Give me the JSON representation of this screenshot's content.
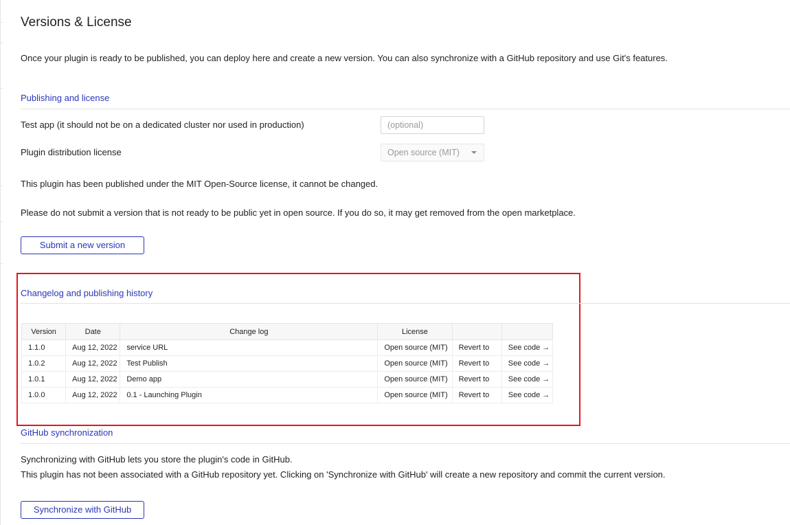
{
  "page": {
    "title": "Versions & License",
    "intro": "Once your plugin is ready to be published, you can deploy here and create a new version. You can also synchronize with a GitHub repository and use Git's features."
  },
  "publishing": {
    "section_title": "Publishing and license",
    "test_app_label": "Test app (it should not be on a dedicated cluster nor used in production)",
    "test_app_placeholder": "(optional)",
    "license_label": "Plugin distribution license",
    "license_value": "Open source (MIT)",
    "license_note": "This plugin has been published under the MIT Open-Source license, it cannot be changed.",
    "warning": "Please do not submit a version that is not ready to be public yet in open source. If you do so, it may get removed from the open marketplace.",
    "submit_label": "Submit a new version"
  },
  "changelog": {
    "section_title": "Changelog and publishing history",
    "columns": [
      "Version",
      "Date",
      "Change log",
      "License",
      "",
      ""
    ],
    "rows": [
      {
        "version": "1.1.0",
        "date": "Aug 12, 2022",
        "log": "service URL",
        "license": "Open source (MIT)",
        "revert": "Revert to",
        "code": "See code →"
      },
      {
        "version": "1.0.2",
        "date": "Aug 12, 2022",
        "log": "Test Publish",
        "license": "Open source (MIT)",
        "revert": "Revert to",
        "code": "See code →"
      },
      {
        "version": "1.0.1",
        "date": "Aug 12, 2022",
        "log": "Demo app",
        "license": "Open source (MIT)",
        "revert": "Revert to",
        "code": "See code →"
      },
      {
        "version": "1.0.0",
        "date": "Aug 12, 2022",
        "log": "0.1 - Launching Plugin",
        "license": "Open source (MIT)",
        "revert": "Revert to",
        "code": "See code →"
      }
    ]
  },
  "github": {
    "section_title": "GitHub synchronization",
    "line1": "Synchronizing with GitHub lets you store the plugin's code in GitHub.",
    "line2": "This plugin has not been associated with a GitHub repository yet. Clicking on 'Synchronize with GitHub' will create a new repository and commit the current version.",
    "sync_label": "Synchronize with GitHub"
  },
  "colors": {
    "accent": "#2b36b8",
    "highlight": "#e8141b"
  }
}
